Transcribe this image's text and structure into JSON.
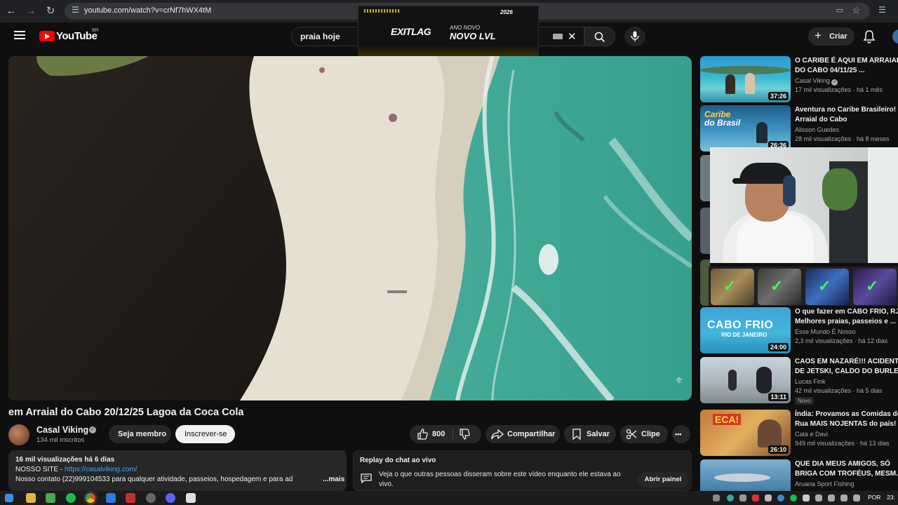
{
  "browser": {
    "url": "youtube.com/watch?v=crNf7hWX4tM",
    "back_icon": "arrow-left-icon",
    "forward_icon": "arrow-right-icon",
    "reload_icon": "reload-icon"
  },
  "header": {
    "logo_text": "YouTube",
    "country_code": "BR",
    "search_value": "praia hoje",
    "create_label": "Criar"
  },
  "ad": {
    "brand": "EXITLAG",
    "small": "ANO NOVO",
    "big": "NOVO LVL",
    "year": "2026"
  },
  "video": {
    "title": "em Arraial do Cabo 20/12/25 Lagoa da Coca Cola"
  },
  "channel": {
    "name": "Casal Viking",
    "subscribers": "134 mil inscritos",
    "join_label": "Seja membro",
    "subscribe_label": "Inscrever-se"
  },
  "actions": {
    "like_count": "800",
    "share_label": "Compartilhar",
    "save_label": "Salvar",
    "clip_label": "Clipe",
    "more_label": "•••"
  },
  "description": {
    "meta": "16 mil visualizações  há 6 dias",
    "site_prefix": "NOSSO SITE - ",
    "site_link": "https://casalviking.com/",
    "contact": "Nosso contato (22)999104533 para qualquer atividade, passeios, hospedagem e para ad",
    "more_label": "...mais"
  },
  "chat": {
    "title": "Replay do chat ao vivo",
    "text": "Veja o que outras pessoas disseram sobre este vídeo enquanto ele estava ao vivo.",
    "open_label": "Abrir painel"
  },
  "recommendations": [
    {
      "title1": "O CARIBE É AQUI EM ARRAIAL",
      "title2": "DO CABO 04/11/25 ...",
      "channel": "Casal Viking",
      "meta": "17 mil visualizações · há 1 mês",
      "duration": "37:26"
    },
    {
      "title1": "Aventura no Caribe Brasileiro!",
      "title2": "Arraial do Cabo",
      "channel": "Alisson Guedes",
      "meta": "28 mil visualizações · há 8 meses",
      "duration": "26:36",
      "thumb_text1": "Caribe",
      "thumb_text2": "do Brasil"
    },
    {
      "title1": "O que fazer em CABO FRIO, RJ",
      "title2": "Melhores praias, passeios e ...",
      "channel": "Esse Mundo É Nosso",
      "meta": "2,3 mil visualizações · há 12 dias",
      "duration": "24:00",
      "thumb_text1": "CABO FRIO",
      "thumb_text2": "RIO DE JANEIRO"
    },
    {
      "title1": "CAOS EM NAZARÉ!!! ACIDENTE",
      "title2": "DE JETSKI, CALDO DO BURLE",
      "channel": "Lucas Fink",
      "meta": "42 mil visualizações · há 5 dias",
      "duration": "13:11",
      "badge": "Novo"
    },
    {
      "title1": "Índia: Provamos as Comidas de",
      "title2": "Rua MAIS NOJENTAS do país!",
      "channel": "Cata e Davi",
      "meta": "949 mil visualizações · há 13 dias",
      "duration": "26:10",
      "thumb_text1": "ECA!"
    },
    {
      "title1": "QUE DIA MEUS AMIGOS, SÓ",
      "title2": "BRIGA COM TROFÉUS, MESM...",
      "channel": "Aruana Sport Fishing"
    }
  ],
  "taskbar": {
    "lang": "POR",
    "time": "23:"
  }
}
